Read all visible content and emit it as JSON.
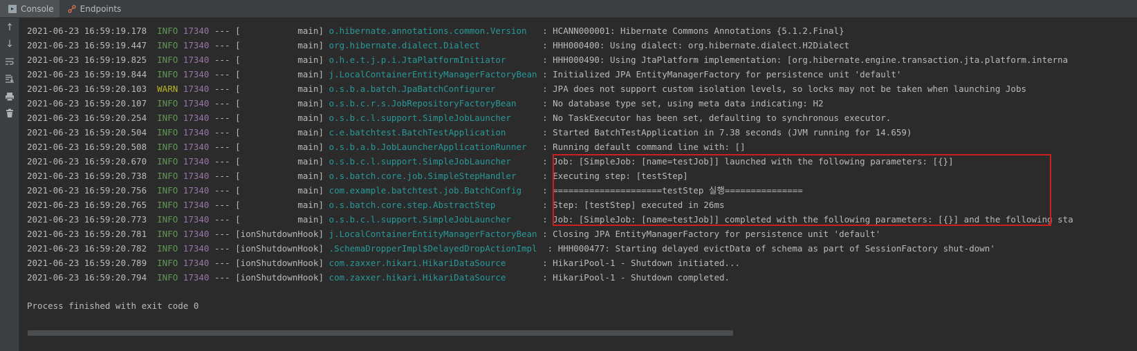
{
  "tabs": [
    {
      "label": "Console",
      "icon": "console-icon"
    },
    {
      "label": "Endpoints",
      "icon": "endpoints-icon"
    }
  ],
  "toolbar": [
    "arrow-up-icon",
    "arrow-down-icon",
    "soft-wrap-icon",
    "scroll-to-end-icon",
    "print-icon",
    "trash-icon"
  ],
  "log": [
    {
      "ts": "2021-06-23 16:59:19.178",
      "level": "INFO",
      "pid": "17340",
      "thread": "           main",
      "logger": "o.hibernate.annotations.common.Version  ",
      "msg": "HCANN000001: Hibernate Commons Annotations {5.1.2.Final}"
    },
    {
      "ts": "2021-06-23 16:59:19.447",
      "level": "INFO",
      "pid": "17340",
      "thread": "           main",
      "logger": "org.hibernate.dialect.Dialect           ",
      "msg": "HHH000400: Using dialect: org.hibernate.dialect.H2Dialect"
    },
    {
      "ts": "2021-06-23 16:59:19.825",
      "level": "INFO",
      "pid": "17340",
      "thread": "           main",
      "logger": "o.h.e.t.j.p.i.JtaPlatformInitiator      ",
      "msg": "HHH000490: Using JtaPlatform implementation: [org.hibernate.engine.transaction.jta.platform.interna"
    },
    {
      "ts": "2021-06-23 16:59:19.844",
      "level": "INFO",
      "pid": "17340",
      "thread": "           main",
      "logger": "j.LocalContainerEntityManagerFactoryBean",
      "msg": "Initialized JPA EntityManagerFactory for persistence unit 'default'"
    },
    {
      "ts": "2021-06-23 16:59:20.103",
      "level": "WARN",
      "pid": "17340",
      "thread": "           main",
      "logger": "o.s.b.a.batch.JpaBatchConfigurer        ",
      "msg": "JPA does not support custom isolation levels, so locks may not be taken when launching Jobs"
    },
    {
      "ts": "2021-06-23 16:59:20.107",
      "level": "INFO",
      "pid": "17340",
      "thread": "           main",
      "logger": "o.s.b.c.r.s.JobRepositoryFactoryBean    ",
      "msg": "No database type set, using meta data indicating: H2"
    },
    {
      "ts": "2021-06-23 16:59:20.254",
      "level": "INFO",
      "pid": "17340",
      "thread": "           main",
      "logger": "o.s.b.c.l.support.SimpleJobLauncher     ",
      "msg": "No TaskExecutor has been set, defaulting to synchronous executor."
    },
    {
      "ts": "2021-06-23 16:59:20.504",
      "level": "INFO",
      "pid": "17340",
      "thread": "           main",
      "logger": "c.e.batchtest.BatchTestApplication      ",
      "msg": "Started BatchTestApplication in 7.38 seconds (JVM running for 14.659)"
    },
    {
      "ts": "2021-06-23 16:59:20.508",
      "level": "INFO",
      "pid": "17340",
      "thread": "           main",
      "logger": "o.s.b.a.b.JobLauncherApplicationRunner  ",
      "msg": "Running default command line with: []"
    },
    {
      "ts": "2021-06-23 16:59:20.670",
      "level": "INFO",
      "pid": "17340",
      "thread": "           main",
      "logger": "o.s.b.c.l.support.SimpleJobLauncher     ",
      "msg": "Job: [SimpleJob: [name=testJob]] launched with the following parameters: [{}]"
    },
    {
      "ts": "2021-06-23 16:59:20.738",
      "level": "INFO",
      "pid": "17340",
      "thread": "           main",
      "logger": "o.s.batch.core.job.SimpleStepHandler    ",
      "msg": "Executing step: [testStep]"
    },
    {
      "ts": "2021-06-23 16:59:20.756",
      "level": "INFO",
      "pid": "17340",
      "thread": "           main",
      "logger": "com.example.batchtest.job.BatchConfig   ",
      "msg": "=====================testStep 실행==============="
    },
    {
      "ts": "2021-06-23 16:59:20.765",
      "level": "INFO",
      "pid": "17340",
      "thread": "           main",
      "logger": "o.s.batch.core.step.AbstractStep        ",
      "msg": "Step: [testStep] executed in 26ms"
    },
    {
      "ts": "2021-06-23 16:59:20.773",
      "level": "INFO",
      "pid": "17340",
      "thread": "           main",
      "logger": "o.s.b.c.l.support.SimpleJobLauncher     ",
      "msg": "Job: [SimpleJob: [name=testJob]] completed with the following parameters: [{}] and the following sta"
    },
    {
      "ts": "2021-06-23 16:59:20.781",
      "level": "INFO",
      "pid": "17340",
      "thread": "ionShutdownHook",
      "logger": "j.LocalContainerEntityManagerFactoryBean",
      "msg": "Closing JPA EntityManagerFactory for persistence unit 'default'"
    },
    {
      "ts": "2021-06-23 16:59:20.782",
      "level": "INFO",
      "pid": "17340",
      "thread": "ionShutdownHook",
      "logger": ".SchemaDropperImpl$DelayedDropActionImpl ",
      "msg": "HHH000477: Starting delayed evictData of schema as part of SessionFactory shut-down'"
    },
    {
      "ts": "2021-06-23 16:59:20.789",
      "level": "INFO",
      "pid": "17340",
      "thread": "ionShutdownHook",
      "logger": "com.zaxxer.hikari.HikariDataSource      ",
      "msg": "HikariPool-1 - Shutdown initiated..."
    },
    {
      "ts": "2021-06-23 16:59:20.794",
      "level": "INFO",
      "pid": "17340",
      "thread": "ionShutdownHook",
      "logger": "com.zaxxer.hikari.HikariDataSource      ",
      "msg": "HikariPool-1 - Shutdown completed."
    }
  ],
  "exit_message": "Process finished with exit code 0",
  "colors": {
    "info": "#629755",
    "warn": "#bbb529",
    "pid": "#9876aa",
    "logger": "#299999",
    "highlight": "#d11f1f"
  }
}
